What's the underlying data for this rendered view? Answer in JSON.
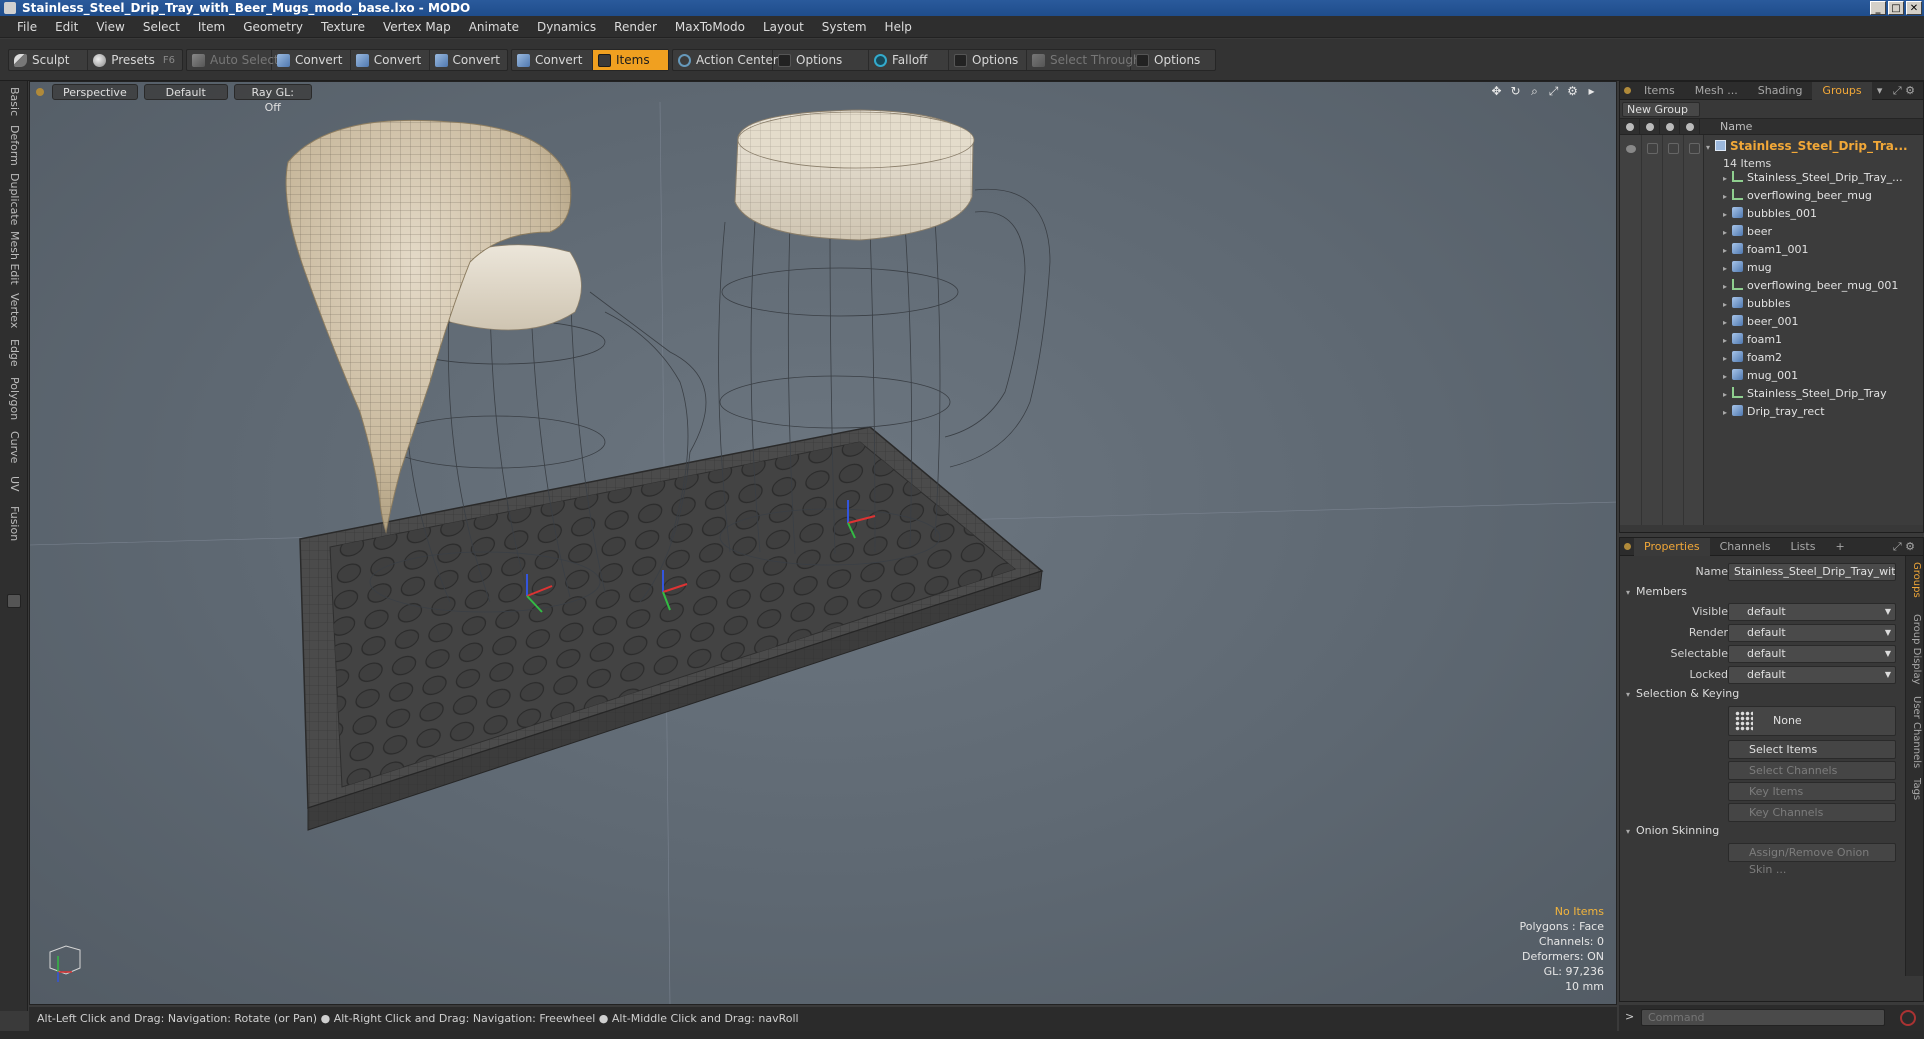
{
  "window": {
    "title": "Stainless_Steel_Drip_Tray_with_Beer_Mugs_modo_base.lxo - MODO",
    "controls": [
      "_",
      "□",
      "✕"
    ]
  },
  "menu": [
    "File",
    "Edit",
    "View",
    "Select",
    "Item",
    "Geometry",
    "Texture",
    "Vertex Map",
    "Animate",
    "Dynamics",
    "Render",
    "MaxToModo",
    "Layout",
    "System",
    "Help"
  ],
  "toolbar": {
    "sculpt": "Sculpt",
    "presets": "Presets",
    "presets_key": "F6",
    "auto_select": "Auto Select",
    "convert_1": "Convert",
    "convert_2": "Convert",
    "convert_3": "Convert",
    "convert_4": "Convert",
    "items": "Items",
    "action_center": "Action Center",
    "options_1": "Options",
    "falloff": "Falloff",
    "options_2": "Options",
    "select_through": "Select Through",
    "options_3": "Options"
  },
  "left_tabs": [
    "Basic",
    "Deform",
    "Duplicate",
    "Mesh Edit",
    "Vertex",
    "Edge",
    "Polygon",
    "Curve",
    "UV",
    "Fusion"
  ],
  "viewport": {
    "view_mode": "Perspective",
    "shading": "Default",
    "raygl": "Ray GL: Off",
    "info": {
      "selection": "No Items",
      "polygons": "Polygons : Face",
      "channels": "Channels: 0",
      "deformers": "Deformers: ON",
      "gl": "GL: 97,236",
      "scale": "10 mm"
    }
  },
  "status": "Alt-Left Click and Drag: Navigation: Rotate (or Pan) ● Alt-Right Click and Drag: Navigation: Freewheel ● Alt-Middle Click and Drag: navRoll",
  "item_panel": {
    "tabs": [
      "Items",
      "Mesh ...",
      "Shading",
      "Groups"
    ],
    "active_tab": "Groups",
    "new_group": "New Group",
    "name_col": "Name",
    "group_name": "Stainless_Steel_Drip_Tra...",
    "group_count": "14 Items",
    "items": [
      {
        "name": "Stainless_Steel_Drip_Tray_...",
        "kind": "locator"
      },
      {
        "name": "overflowing_beer_mug",
        "kind": "locator"
      },
      {
        "name": "bubbles_001",
        "kind": "mesh"
      },
      {
        "name": "beer",
        "kind": "mesh"
      },
      {
        "name": "foam1_001",
        "kind": "mesh"
      },
      {
        "name": "mug",
        "kind": "mesh"
      },
      {
        "name": "overflowing_beer_mug_001",
        "kind": "locator"
      },
      {
        "name": "bubbles",
        "kind": "mesh"
      },
      {
        "name": "beer_001",
        "kind": "mesh"
      },
      {
        "name": "foam1",
        "kind": "mesh"
      },
      {
        "name": "foam2",
        "kind": "mesh"
      },
      {
        "name": "mug_001",
        "kind": "mesh"
      },
      {
        "name": "Stainless_Steel_Drip_Tray",
        "kind": "locator"
      },
      {
        "name": "Drip_tray_rect",
        "kind": "mesh"
      }
    ]
  },
  "props_panel": {
    "tabs": [
      "Properties",
      "Channels",
      "Lists",
      "+"
    ],
    "name_label": "Name",
    "name_value": "Stainless_Steel_Drip_Tray_with_",
    "members_header": "Members",
    "visible_label": "Visible",
    "visible_value": "default",
    "render_label": "Render",
    "render_value": "default",
    "selectable_label": "Selectable",
    "selectable_value": "default",
    "locked_label": "Locked",
    "locked_value": "default",
    "sel_keying_header": "Selection & Keying",
    "none_btn": "None",
    "select_items": "Select Items",
    "select_channels": "Select Channels",
    "key_items": "Key Items",
    "key_channels": "Key Channels",
    "onion_header": "Onion Skinning",
    "onion_btn": "Assign/Remove Onion Skin ...",
    "side_tabs": [
      "Groups",
      "Group Display",
      "User Channels",
      "Tags"
    ]
  },
  "command": {
    "prompt": ">",
    "placeholder": "Command"
  },
  "colors": {
    "accent": "#f0a020",
    "selected_text": "#f2a838",
    "viewport_bg": "#5e6872"
  }
}
